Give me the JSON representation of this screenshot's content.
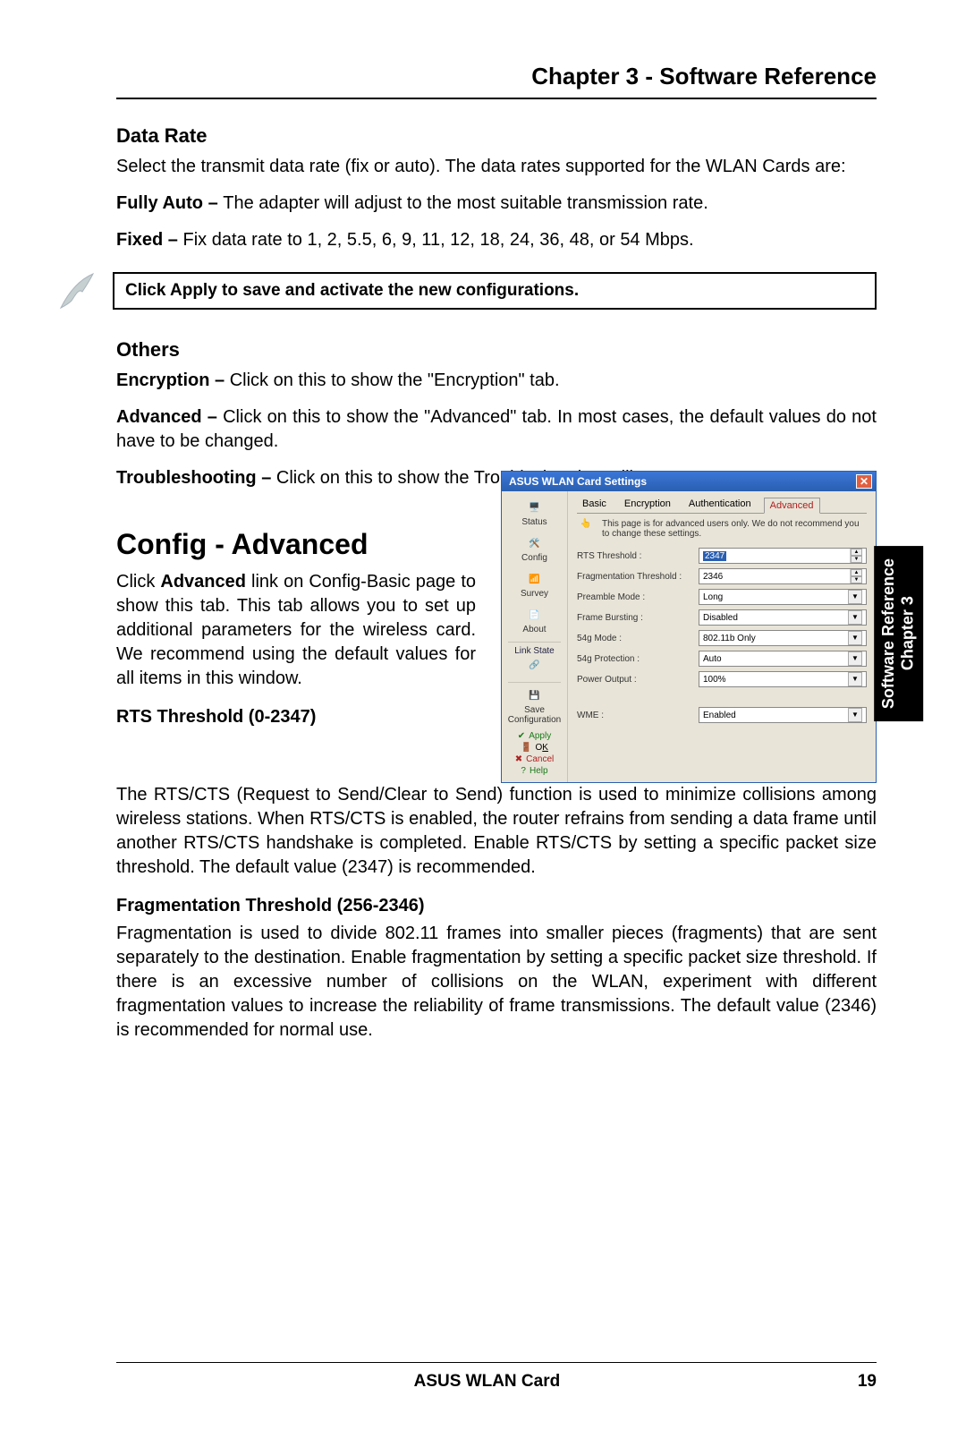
{
  "chapter_title": "Chapter 3 - Software Reference",
  "side_tab": {
    "line1": "Chapter 3",
    "line2": "Software Reference"
  },
  "data_rate": {
    "heading": "Data Rate",
    "intro": "Select the transmit data rate (fix or auto). The data rates supported for the WLAN Cards are:",
    "fully_auto_b": "Fully Auto – ",
    "fully_auto_t": "The adapter will adjust to the most suitable transmission rate.",
    "fixed_b": "Fixed – ",
    "fixed_t": "Fix data rate to 1, 2, 5.5, 6, 9, 11, 12, 18, 24, 36, 48, or 54 Mbps."
  },
  "note": "Click Apply to save and activate the new configurations.",
  "others": {
    "heading": "Others",
    "enc_b": "Encryption – ",
    "enc_t": "Click on this to show the \"Encryption\" tab.",
    "adv_b": "Advanced – ",
    "adv_t": "Click on this to show the \"Advanced\" tab. In most cases, the default values do not have to be changed.",
    "tr_b": "Troubleshooting – ",
    "tr_t": "Click on this to show the Troubleshooting utility."
  },
  "config": {
    "heading": "Config - Advanced",
    "intro_a": "Click ",
    "intro_b": "Advanced",
    "intro_c": " link on Config-Basic page to show this tab. This tab allows you to set up additional parameters for the wireless card. We recommend using the default values for all items in this window.",
    "rts_h": "RTS Threshold (0-2347)",
    "rts_t": "The RTS/CTS (Request to Send/Clear to Send) function is used to minimize collisions among wireless stations. When RTS/CTS is enabled, the router refrains from sending a data frame until another RTS/CTS handshake is completed. Enable RTS/CTS by setting a specific packet size threshold. The default value (2347) is recommended.",
    "frag_h": "Fragmentation Threshold (256-2346)",
    "frag_t": "Fragmentation is used to divide 802.11 frames into smaller pieces (fragments) that are sent separately to the destination. Enable fragmentation by setting a specific packet size threshold. If there is an excessive number of collisions on the WLAN, experiment with different fragmentation values to increase the reliability of frame transmissions. The default value (2346) is recommended for normal use."
  },
  "dialog": {
    "title": "ASUS WLAN Card Settings",
    "side": {
      "status": "Status",
      "config": "Config",
      "survey": "Survey",
      "about": "About",
      "link_state": "Link State",
      "save_config": "Save Configuration",
      "apply": "Apply",
      "ok": "OK",
      "cancel": "Cancel",
      "help": "Help"
    },
    "tabs": {
      "basic": "Basic",
      "encryption": "Encryption",
      "authentication": "Authentication",
      "advanced": "Advanced"
    },
    "info": "This page is for advanced users only. We do not recommend you to change these settings.",
    "fields": {
      "rts_label": "RTS Threshold :",
      "rts_value": "2347",
      "frag_label": "Fragmentation Threshold :",
      "frag_value": "2346",
      "preamble_label": "Preamble Mode :",
      "preamble_value": "Long",
      "burst_label": "Frame Bursting :",
      "burst_value": "Disabled",
      "mode_label": "54g Mode :",
      "mode_value": "802.11b Only",
      "prot_label": "54g Protection :",
      "prot_value": "Auto",
      "power_label": "Power Output :",
      "power_value": "100%",
      "wme_label": "WME :",
      "wme_value": "Enabled"
    }
  },
  "footer": {
    "center": "ASUS WLAN Card",
    "page": "19"
  }
}
